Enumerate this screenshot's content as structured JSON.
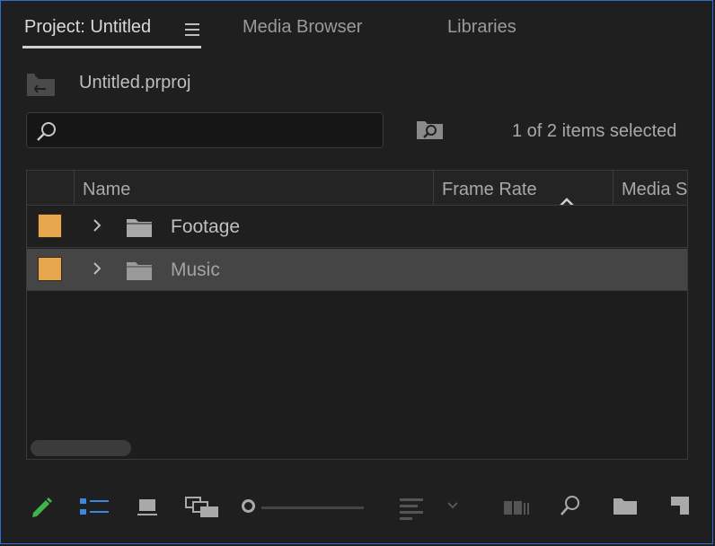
{
  "tabs": [
    {
      "label": "Project: Untitled",
      "active": true
    },
    {
      "label": "Media Browser",
      "active": false
    },
    {
      "label": "Libraries",
      "active": false
    }
  ],
  "project": {
    "file_name": "Untitled.prproj"
  },
  "search": {
    "value": "",
    "placeholder": ""
  },
  "selection_status": "1 of 2 items selected",
  "table": {
    "columns": [
      "",
      "Name",
      "Frame Rate",
      "Media S"
    ],
    "sort_column": "Frame Rate",
    "sort_direction": "ascending",
    "rows": [
      {
        "name": "Footage",
        "label_color": "#e6a74e",
        "type": "folder",
        "selected": false
      },
      {
        "name": "Music",
        "label_color": "#e6a74e",
        "type": "folder",
        "selected": true
      }
    ]
  },
  "toolbar": {
    "icons": [
      "pencil-icon",
      "list-view-icon",
      "icon-view-icon",
      "freeform-view-icon",
      "zoom-slider",
      "sort-icons-icon",
      "automate-to-sequence-icon",
      "find-icon",
      "new-bin-icon",
      "new-item-icon"
    ],
    "zoom_level": 0.0
  },
  "colors": {
    "accent": "#2d6fd6",
    "label_mango": "#e6a74e",
    "write_pencil": "#3fb54a",
    "list_view_active": "#3b86e0"
  }
}
